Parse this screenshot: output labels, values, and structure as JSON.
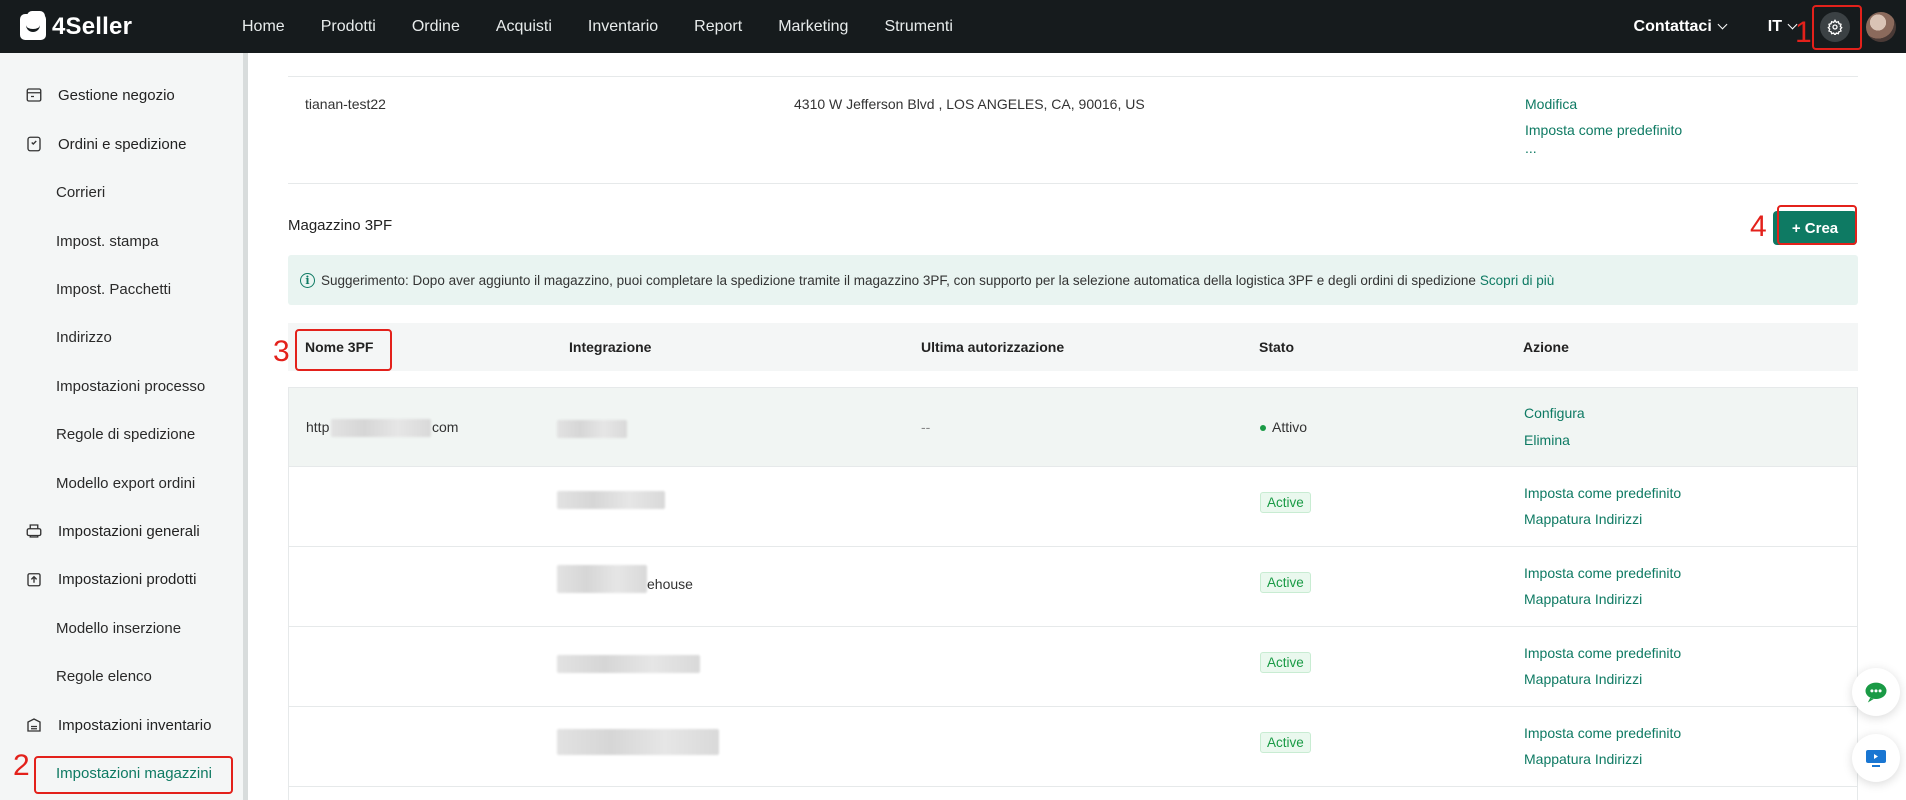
{
  "brand": {
    "name": "4Seller"
  },
  "nav": {
    "items": [
      "Home",
      "Prodotti",
      "Ordine",
      "Acquisti",
      "Inventario",
      "Report",
      "Marketing",
      "Strumenti"
    ],
    "contact": "Contattaci",
    "lang": "IT"
  },
  "sidebar": {
    "items": [
      {
        "label": "Gestione negozio",
        "icon": "store-icon"
      },
      {
        "label": "Ordini e spedizione",
        "icon": "order-icon"
      },
      {
        "label": "Corrieri"
      },
      {
        "label": "Impost. stampa"
      },
      {
        "label": "Impost. Pacchetti"
      },
      {
        "label": "Indirizzo"
      },
      {
        "label": "Impostazioni processo"
      },
      {
        "label": "Regole di spedizione"
      },
      {
        "label": "Modello export ordini"
      },
      {
        "label": "Impostazioni generali",
        "icon": "printer-icon"
      },
      {
        "label": "Impostazioni prodotti",
        "icon": "upload-box-icon"
      },
      {
        "label": "Modello inserzione"
      },
      {
        "label": "Regole elenco"
      },
      {
        "label": "Impostazioni inventario",
        "icon": "inventory-icon"
      },
      {
        "label": "Impostazioni magazzini",
        "active": true
      }
    ]
  },
  "address_row": {
    "name": "tianan-test22",
    "address": "4310 W Jefferson Blvd , LOS ANGELES, CA, 90016, US",
    "actions": [
      "Modifica",
      "Imposta come predefinito",
      "..."
    ]
  },
  "warehouse": {
    "title": "Magazzino 3PF",
    "create_label": "+ Crea",
    "tip": "Suggerimento: Dopo aver aggiunto il magazzino, puoi completare la spedizione tramite il magazzino 3PF, con supporto per la selezione automatica della logistica 3PF e degli ordini di spedizione",
    "tip_link": "Scopri di più",
    "columns": [
      "Nome 3PF",
      "Integrazione",
      "Ultima autorizzazione",
      "Stato",
      "Azione"
    ],
    "rows": [
      {
        "name_prefix": "http",
        "name_suffix": "com",
        "integration": "",
        "last_auth": "--",
        "status": "Attivo",
        "actions": [
          "Configura",
          "Elimina"
        ]
      },
      {
        "integration_suffix": "",
        "status": "Active",
        "actions": [
          "Imposta come predefinito",
          "Mappatura Indirizzi"
        ]
      },
      {
        "integration_suffix": "ehouse",
        "status": "Active",
        "actions": [
          "Imposta come predefinito",
          "Mappatura Indirizzi"
        ]
      },
      {
        "integration_suffix": "",
        "status": "Active",
        "actions": [
          "Imposta come predefinito",
          "Mappatura Indirizzi"
        ]
      },
      {
        "integration_suffix": "",
        "status": "Active",
        "actions": [
          "Imposta come predefinito",
          "Mappatura Indirizzi"
        ]
      }
    ]
  },
  "annotations": [
    "1",
    "2",
    "3",
    "4"
  ],
  "colors": {
    "brand": "#0e7a63",
    "annotation": "#e3211b",
    "topbar": "#161b1d"
  }
}
